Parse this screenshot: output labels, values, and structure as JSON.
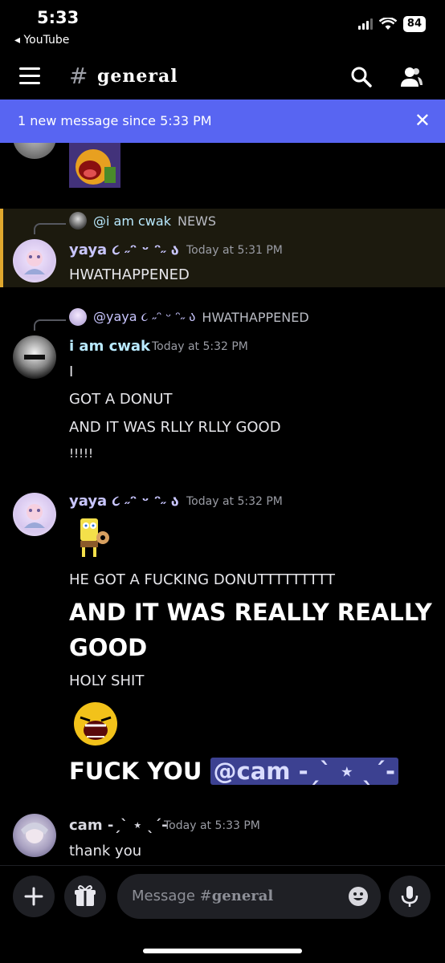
{
  "status": {
    "time": "5:33",
    "back_app": "◂ YouTube",
    "battery": "84"
  },
  "header": {
    "hash": "#",
    "channel": "general"
  },
  "banner": {
    "text": "1 new message since 5:33 PM",
    "close": "✕"
  },
  "messages": [
    {
      "reply_to": {
        "name": "@i am cwak",
        "text": "NEWS"
      },
      "author": "yaya ૮ ˶ᵔ ᵕ ᵔ˶ ა",
      "timestamp": "Today at 5:31 PM",
      "lines": [
        "HWATHAPPENED"
      ],
      "highlighted": true
    },
    {
      "reply_to": {
        "name": "@yaya ૮ ˶ᵔ ᵕ ᵔ˶ ა",
        "text": "HWATHAPPENED"
      },
      "author": "i am cwak",
      "timestamp": "Today at 5:32 PM",
      "lines": [
        "I",
        "GOT A DONUT",
        "AND IT WAS RLLY RLLY GOOD",
        "!!!!!"
      ]
    },
    {
      "author": "yaya ૮ ˶ᵔ ᵕ ᵔ˶ ა",
      "timestamp": "Today at 5:32 PM",
      "lines": [
        "HE GOT A FUCKING DONUTTTTTTTTT",
        "AND IT WAS REALLY REALLY",
        "GOOD",
        "HOLY SHIT",
        "FUCK YOU",
        "@cam -ˏˋ ⋆ ˎˊ-"
      ]
    },
    {
      "author": "cam -ˏˋ ⋆ ˎˊ-",
      "timestamp": "Today at 5:33 PM",
      "lines": [
        "thank you"
      ]
    }
  ],
  "composer": {
    "placeholder_prefix": "Message #",
    "placeholder_channel": "general"
  },
  "colors": {
    "accent": "#5865f2",
    "yaya_name": "#c9c6ff",
    "cwak_name": "#b9eaff",
    "cam_name": "#d8d8e0",
    "mention_bg": "#3c4191"
  }
}
